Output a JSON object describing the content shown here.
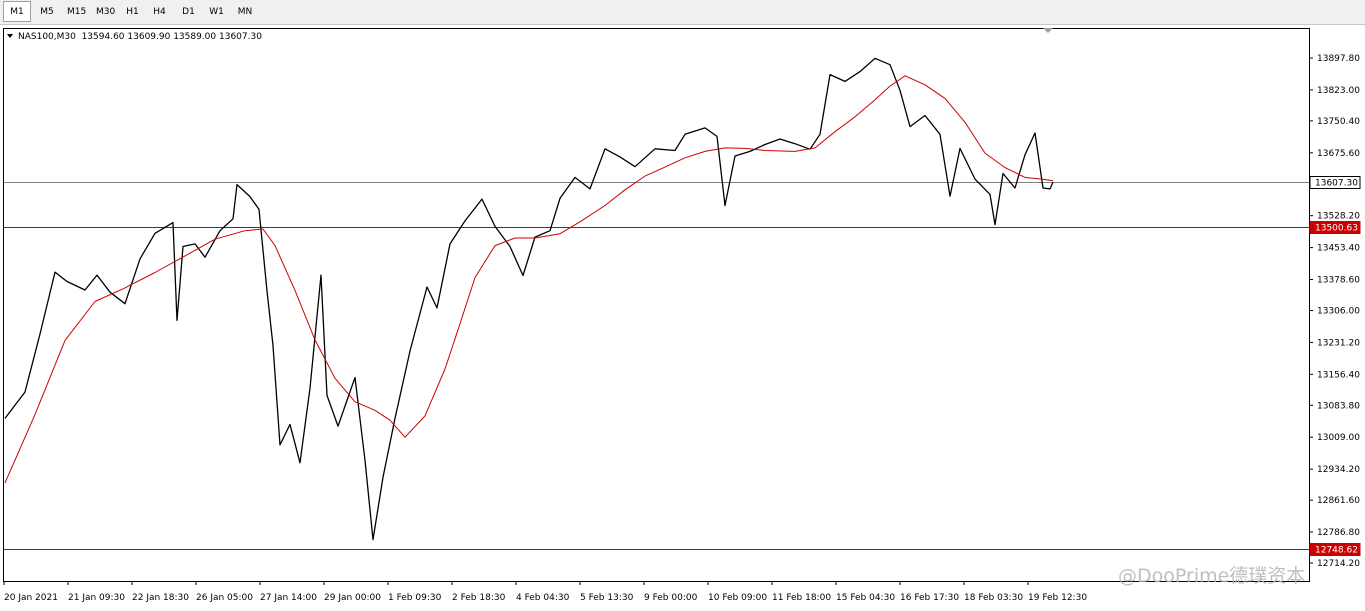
{
  "toolbar": {
    "timeframes": [
      "M1",
      "M5",
      "M15",
      "M30",
      "H1",
      "H4",
      "D1",
      "W1",
      "MN"
    ],
    "active": "M1"
  },
  "chart_data": {
    "type": "line",
    "header": "NAS100,M30  13594.60 13609.90 13589.00 13607.30",
    "yticks": [
      "13897.80",
      "13823.00",
      "13750.40",
      "13675.60",
      "13528.20",
      "13453.40",
      "13378.60",
      "13306.00",
      "13231.20",
      "13156.40",
      "13083.80",
      "13009.00",
      "12934.20",
      "12861.60",
      "12786.80",
      "12714.20"
    ],
    "ylim": [
      12714.2,
      13897.8
    ],
    "xticks": [
      "20 Jan 2021",
      "21 Jan 09:30",
      "22 Jan 18:30",
      "26 Jan 05:00",
      "27 Jan 14:00",
      "29 Jan 00:00",
      "1 Feb 09:30",
      "2 Feb 18:30",
      "4 Feb 04:30",
      "5 Feb 13:30",
      "9 Feb 00:00",
      "10 Feb 09:00",
      "11 Feb 18:00",
      "15 Feb 04:30",
      "16 Feb 17:30",
      "18 Feb 03:30",
      "19 Feb 12:30"
    ],
    "price_line": {
      "value": 13607.3,
      "label": "13607.30",
      "color": "#808080"
    },
    "hlines": [
      {
        "value": 13500.63,
        "label": "13500.63",
        "color": "#cc0000"
      },
      {
        "value": 12748.0,
        "label": "12748.62",
        "color": "#cc0000"
      }
    ],
    "series": [
      {
        "type": "price",
        "color": "#000000",
        "points": [
          [
            0,
            13053
          ],
          [
            20,
            13115
          ],
          [
            35,
            13251
          ],
          [
            50,
            13396
          ],
          [
            62,
            13374
          ],
          [
            80,
            13354
          ],
          [
            92,
            13389
          ],
          [
            105,
            13349
          ],
          [
            120,
            13322
          ],
          [
            135,
            13427
          ],
          [
            150,
            13487
          ],
          [
            168,
            13512
          ],
          [
            172,
            13283
          ],
          [
            178,
            13456
          ],
          [
            190,
            13462
          ],
          [
            200,
            13431
          ],
          [
            215,
            13493
          ],
          [
            228,
            13521
          ],
          [
            232,
            13601
          ],
          [
            245,
            13573
          ],
          [
            254,
            13543
          ],
          [
            262,
            13352
          ],
          [
            268,
            13224
          ],
          [
            275,
            12991
          ],
          [
            285,
            13039
          ],
          [
            295,
            12949
          ],
          [
            305,
            13124
          ],
          [
            316,
            13389
          ],
          [
            322,
            13107
          ],
          [
            333,
            13035
          ],
          [
            350,
            13149
          ],
          [
            360,
            12955
          ],
          [
            368,
            12769
          ],
          [
            378,
            12915
          ],
          [
            390,
            13053
          ],
          [
            405,
            13211
          ],
          [
            422,
            13361
          ],
          [
            432,
            13312
          ],
          [
            445,
            13462
          ],
          [
            460,
            13516
          ],
          [
            477,
            13567
          ],
          [
            490,
            13503
          ],
          [
            505,
            13456
          ],
          [
            518,
            13388
          ],
          [
            530,
            13478
          ],
          [
            545,
            13493
          ],
          [
            555,
            13569
          ],
          [
            570,
            13618
          ],
          [
            585,
            13591
          ],
          [
            600,
            13685
          ],
          [
            615,
            13666
          ],
          [
            630,
            13643
          ],
          [
            650,
            13685
          ],
          [
            670,
            13681
          ],
          [
            680,
            13719
          ],
          [
            700,
            13734
          ],
          [
            712,
            13714
          ],
          [
            720,
            13552
          ],
          [
            730,
            13668
          ],
          [
            745,
            13679
          ],
          [
            760,
            13695
          ],
          [
            775,
            13708
          ],
          [
            790,
            13697
          ],
          [
            805,
            13684
          ],
          [
            815,
            13719
          ],
          [
            825,
            13859
          ],
          [
            840,
            13843
          ],
          [
            855,
            13866
          ],
          [
            870,
            13897
          ],
          [
            885,
            13882
          ],
          [
            895,
            13822
          ],
          [
            905,
            13737
          ],
          [
            920,
            13763
          ],
          [
            935,
            13719
          ],
          [
            945,
            13574
          ],
          [
            955,
            13686
          ],
          [
            970,
            13614
          ],
          [
            985,
            13578
          ],
          [
            990,
            13507
          ],
          [
            998,
            13627
          ],
          [
            1010,
            13593
          ],
          [
            1020,
            13671
          ],
          [
            1030,
            13722
          ],
          [
            1038,
            13593
          ],
          [
            1045,
            13591
          ],
          [
            1048,
            13607
          ]
        ]
      },
      {
        "type": "moving-average",
        "color": "#cc0000",
        "points": [
          [
            0,
            12902
          ],
          [
            30,
            13062
          ],
          [
            60,
            13236
          ],
          [
            90,
            13327
          ],
          [
            120,
            13359
          ],
          [
            150,
            13395
          ],
          [
            180,
            13434
          ],
          [
            210,
            13473
          ],
          [
            240,
            13493
          ],
          [
            258,
            13497
          ],
          [
            270,
            13458
          ],
          [
            290,
            13353
          ],
          [
            310,
            13237
          ],
          [
            330,
            13147
          ],
          [
            350,
            13092
          ],
          [
            370,
            13072
          ],
          [
            385,
            13049
          ],
          [
            400,
            13009
          ],
          [
            420,
            13059
          ],
          [
            440,
            13169
          ],
          [
            455,
            13275
          ],
          [
            470,
            13383
          ],
          [
            490,
            13458
          ],
          [
            510,
            13476
          ],
          [
            530,
            13476
          ],
          [
            555,
            13486
          ],
          [
            575,
            13514
          ],
          [
            600,
            13552
          ],
          [
            620,
            13589
          ],
          [
            640,
            13621
          ],
          [
            660,
            13642
          ],
          [
            680,
            13664
          ],
          [
            700,
            13679
          ],
          [
            720,
            13687
          ],
          [
            740,
            13686
          ],
          [
            760,
            13681
          ],
          [
            790,
            13679
          ],
          [
            810,
            13687
          ],
          [
            830,
            13725
          ],
          [
            850,
            13760
          ],
          [
            870,
            13800
          ],
          [
            885,
            13832
          ],
          [
            900,
            13856
          ],
          [
            920,
            13835
          ],
          [
            940,
            13803
          ],
          [
            960,
            13747
          ],
          [
            980,
            13675
          ],
          [
            1000,
            13641
          ],
          [
            1020,
            13618
          ],
          [
            1040,
            13613
          ],
          [
            1048,
            13610
          ]
        ]
      }
    ]
  },
  "watermark": "@DooPrime德璞资本"
}
